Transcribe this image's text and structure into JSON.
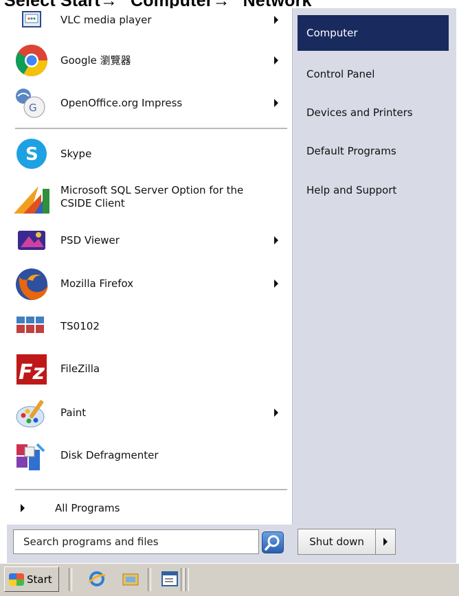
{
  "caption": {
    "part1": "Select Start",
    "part2": "Computer",
    "part3": "Network"
  },
  "programs": [
    {
      "label": "VLC media player",
      "icon": "vlc-icon",
      "submenu": true
    },
    {
      "label": "Google 瀏覽器",
      "icon": "chrome-icon",
      "submenu": true
    },
    {
      "label": "OpenOffice.org Impress",
      "icon": "openoffice-impress-icon",
      "submenu": true
    },
    {
      "label": "Skype",
      "icon": "skype-icon",
      "submenu": false
    },
    {
      "label": "Microsoft SQL Server Option for the CSIDE Client",
      "line1": "Microsoft SQL Server Option for the",
      "line2": "CSIDE Client",
      "icon": "microsoft-dynamics-icon",
      "submenu": false
    },
    {
      "label": "PSD Viewer",
      "icon": "psd-viewer-icon",
      "submenu": true
    },
    {
      "label": "Mozilla Firefox",
      "icon": "firefox-icon",
      "submenu": true
    },
    {
      "label": "TS0102",
      "icon": "ts0102-icon",
      "submenu": false
    },
    {
      "label": "FileZilla",
      "icon": "filezilla-icon",
      "submenu": false
    },
    {
      "label": "Paint",
      "icon": "paint-icon",
      "submenu": true
    },
    {
      "label": "Disk Defragmenter",
      "icon": "disk-defragmenter-icon",
      "submenu": false
    }
  ],
  "all_programs": "All Programs",
  "search": {
    "placeholder": "Search programs and files",
    "value": ""
  },
  "right_pane": {
    "items": [
      {
        "label": "Computer",
        "selected": true
      },
      {
        "label": "Control Panel"
      },
      {
        "label": "Devices and Printers"
      },
      {
        "label": "Default Programs"
      },
      {
        "label": "Help and Support"
      }
    ]
  },
  "shutdown": {
    "label": "Shut down"
  },
  "taskbar": {
    "start_label": "Start"
  },
  "colors": {
    "selected_bg": "#192a5e",
    "menu_bg": "#d8dbe6"
  }
}
